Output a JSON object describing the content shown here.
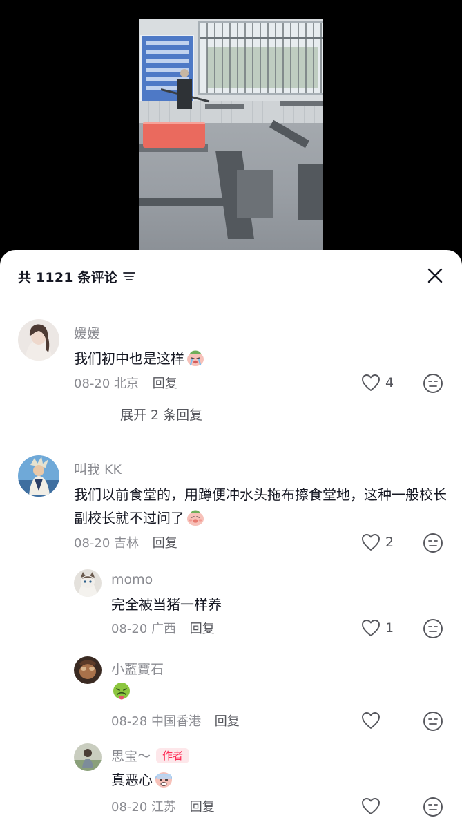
{
  "sheet": {
    "comment_count_label": "共 1121 条评论",
    "filter_icon": "filter-lines-icon",
    "close_icon": "close-icon"
  },
  "colors": {
    "primary_text": "#161823",
    "secondary_text": "#8a8b91",
    "author_badge_text": "#fe2c55",
    "author_badge_bg": "#fde7ea"
  },
  "comments": [
    {
      "username": "媛媛",
      "text": "我们初中也是这样",
      "emoji": "crying-face",
      "date": "08-20",
      "location": "北京",
      "reply_label": "回复",
      "likes": "4",
      "expand_label": "展开 2 条回复"
    },
    {
      "username": "叫我 KK",
      "text": "我们以前食堂的，用蹲便冲水头拖布擦食堂地，这种一般校长副校长就不过问了",
      "emoji": "disgusted-face",
      "date": "08-20",
      "location": "吉林",
      "reply_label": "回复",
      "likes": "2",
      "replies": [
        {
          "username": "momo",
          "text": "完全被当猪一样养",
          "date": "08-20",
          "location": "广西",
          "reply_label": "回复",
          "likes": "1"
        },
        {
          "username": "小藍寶石",
          "text": "",
          "emoji": "nauseated-face",
          "date": "08-28",
          "location": "中国香港",
          "reply_label": "回复",
          "likes": ""
        },
        {
          "username": "思宝～",
          "author_badge": "作者",
          "text": "真恶心",
          "emoji": "fearful-face",
          "date": "08-20",
          "location": "江苏",
          "reply_label": "回复",
          "likes": ""
        }
      ]
    }
  ]
}
